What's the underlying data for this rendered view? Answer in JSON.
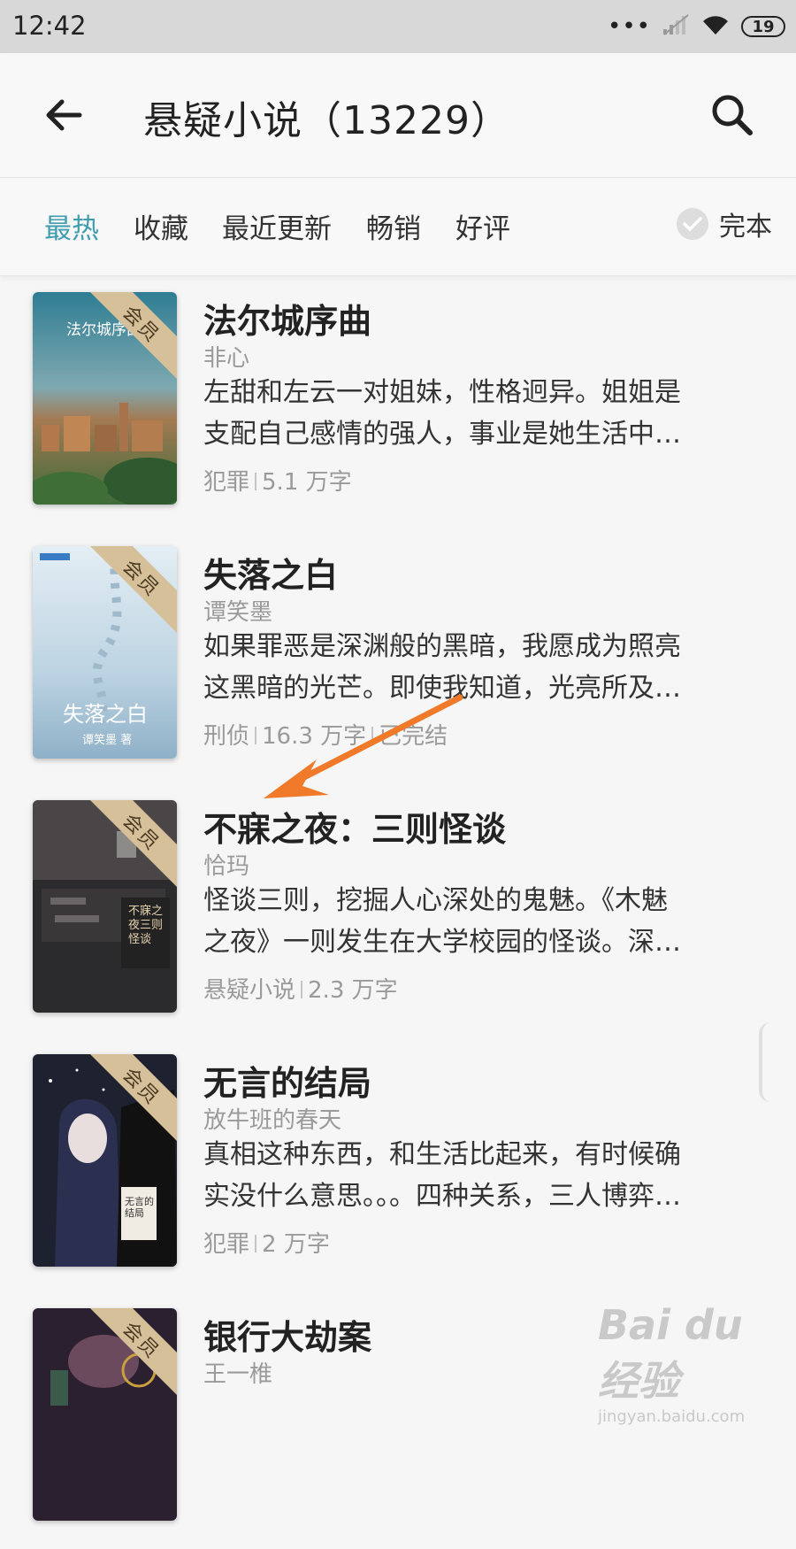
{
  "status_bar": {
    "time": "12:42",
    "battery": "19"
  },
  "header": {
    "title": "悬疑小说（13229）"
  },
  "tabs": [
    {
      "label": "最热",
      "active": true
    },
    {
      "label": "收藏",
      "active": false
    },
    {
      "label": "最近更新",
      "active": false
    },
    {
      "label": "畅销",
      "active": false
    },
    {
      "label": "好评",
      "active": false
    }
  ],
  "filter": {
    "complete_label": "完本"
  },
  "badge_label": "会员",
  "books": [
    {
      "title": "法尔城序曲",
      "author": "非心",
      "desc_line1": "左甜和左云一对姐妹，性格迥异。姐姐是",
      "desc_line2": "支配自己感情的强人，事业是她生活中…",
      "category": "犯罪",
      "words": "5.1 万字",
      "status": "",
      "cover_text": "法尔城序曲"
    },
    {
      "title": "失落之白",
      "author": "谭笑墨",
      "desc_line1": "如果罪恶是深渊般的黑暗，我愿成为照亮",
      "desc_line2": "这黑暗的光芒。即使我知道，光亮所及…",
      "category": "刑侦",
      "words": "16.3 万字",
      "status": "已完结",
      "cover_text": "失落之白",
      "cover_sub": "谭笑墨 著"
    },
    {
      "title": "不寐之夜：三则怪谈",
      "author": "恰玛",
      "desc_line1": "怪谈三则，挖掘人心深处的鬼魅。《木魅",
      "desc_line2": "之夜》一则发生在大学校园的怪谈。深…",
      "category": "悬疑小说",
      "words": "2.3 万字",
      "status": "",
      "cover_text": "不寐之夜三则怪谈"
    },
    {
      "title": "无言的结局",
      "author": "放牛班的春天",
      "desc_line1": "真相这种东西，和生活比起来，有时候确",
      "desc_line2": "实没什么意思。。。四种关系，三人博弈…",
      "category": "犯罪",
      "words": "2 万字",
      "status": "",
      "cover_text": "无言的结局"
    },
    {
      "title": "银行大劫案",
      "author": "王一椎",
      "desc_line1": "",
      "desc_line2": "",
      "category": "",
      "words": "",
      "status": ""
    }
  ],
  "watermark": {
    "main": "Bai du 经验",
    "sub": "jingyan.baidu.com"
  },
  "colors": {
    "accent": "#3f9db0",
    "arrow": "#f07a2a",
    "badge": "#d6c09a"
  },
  "icons": [
    "back-arrow-icon",
    "search-icon",
    "check-icon",
    "wifi-icon",
    "signal-icon"
  ]
}
